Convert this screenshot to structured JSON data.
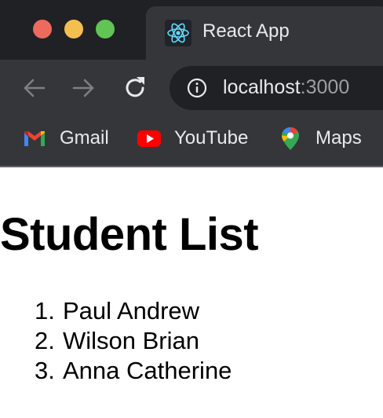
{
  "browser": {
    "tab": {
      "title": "React App",
      "favicon": "react-logo-icon"
    },
    "nav": {
      "back": "arrow-left-icon",
      "forward": "arrow-right-icon",
      "reload": "reload-icon"
    },
    "address": {
      "host": "localhost",
      "port": ":3000",
      "icon": "info-icon"
    },
    "bookmarks": [
      {
        "label": "Gmail",
        "icon": "gmail-icon"
      },
      {
        "label": "YouTube",
        "icon": "youtube-icon"
      },
      {
        "label": "Maps",
        "icon": "maps-icon"
      }
    ],
    "colors": {
      "chrome": "#35363a",
      "tabstrip": "#202124",
      "text": "#e8eaed",
      "react": "#61dafb"
    }
  },
  "page": {
    "title": "Student List",
    "students": [
      {
        "number": "1.",
        "name": "Paul Andrew"
      },
      {
        "number": "2.",
        "name": "Wilson Brian"
      },
      {
        "number": "3.",
        "name": "Anna Catherine"
      }
    ]
  }
}
